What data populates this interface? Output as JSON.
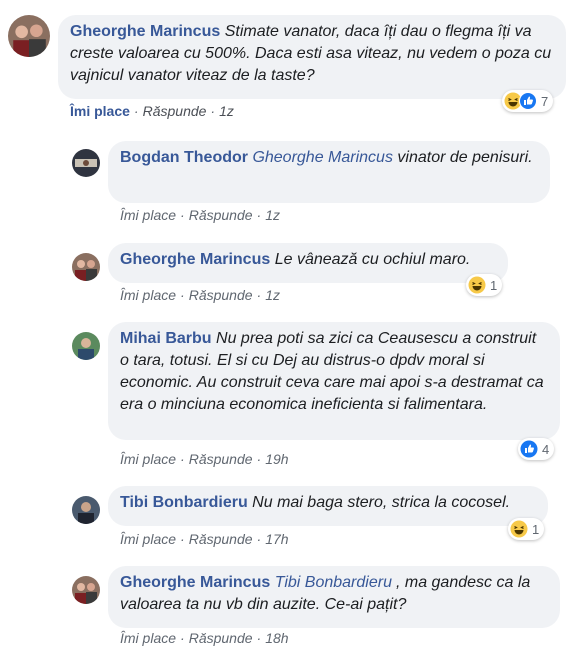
{
  "comments": [
    {
      "author": "Gheorghe Marincus",
      "text": "Stimate vanator, daca îți dau o flegma îți va creste valoarea cu 500%. Daca esti asa viteaz, nu vedem o poza cu vajnicul vanator viteaz de la taste?",
      "like": "Îmi place",
      "reply": "Răspunde",
      "time": "1z",
      "reactions": [
        "haha",
        "like"
      ],
      "reaction_count": "7"
    },
    {
      "author": "Bogdan Theodor",
      "mention": "Gheorghe Marincus",
      "text": "vinator de penisuri.",
      "like": "Îmi place",
      "reply": "Răspunde",
      "time": "1z"
    },
    {
      "author": "Gheorghe Marincus",
      "text": "Le vânează cu ochiul maro.",
      "like": "Îmi place",
      "reply": "Răspunde",
      "time": "1z",
      "reactions": [
        "haha"
      ],
      "reaction_count": "1"
    },
    {
      "author": "Mihai Barbu",
      "text": "Nu prea poti sa zici ca Ceausescu a construit o tara, totusi. El si cu Dej au distrus-o dpdv moral si economic. Au construit ceva care mai apoi s-a destramat ca era o minciuna economica ineficienta si falimentara.",
      "like": "Îmi place",
      "reply": "Răspunde",
      "time": "19h",
      "reactions": [
        "like"
      ],
      "reaction_count": "4"
    },
    {
      "author": "Tibi Bonbardieru",
      "text": "Nu mai baga stero, strica la cocosel.",
      "like": "Îmi place",
      "reply": "Răspunde",
      "time": "17h",
      "reactions": [
        "haha"
      ],
      "reaction_count": "1"
    },
    {
      "author": "Gheorghe Marincus",
      "mention": "Tibi Bonbardieru",
      "text": ", ma gandesc ca la valoarea ta nu vb din auzite. Ce-ai pațit?",
      "like": "Îmi place",
      "reply": "Răspunde",
      "time": "18h"
    }
  ],
  "separator": "·",
  "colors": {
    "bubble": "#f0f2f5",
    "author": "#385898",
    "text": "#1c1e21",
    "meta": "#606770",
    "like_blue": "#1877f2",
    "haha_yellow": "#f7c948"
  }
}
